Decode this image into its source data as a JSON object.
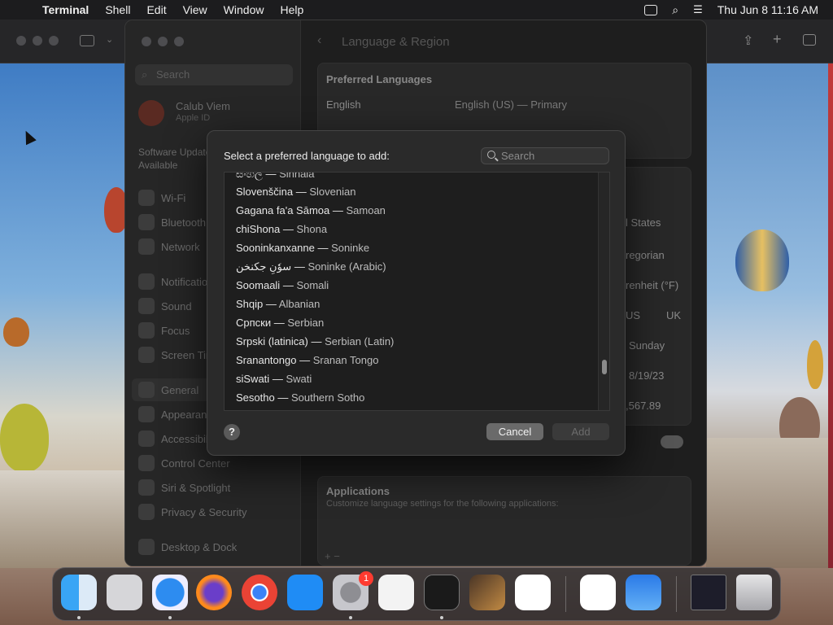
{
  "menubar": {
    "app_name": "Terminal",
    "items": [
      "Shell",
      "Edit",
      "View",
      "Window",
      "Help"
    ],
    "clock": "Thu Jun 8  11:16 AM"
  },
  "settings": {
    "search_placeholder": "Search",
    "user_name": "Calub Viem",
    "user_subtitle": "Apple ID",
    "software_update": "Software Update Available",
    "sidebar_items": [
      "Wi-Fi",
      "Bluetooth",
      "Network",
      "Notifications",
      "Sound",
      "Focus",
      "Screen Time",
      "General",
      "Appearance",
      "Accessibility",
      "Control Center",
      "Siri & Spotlight",
      "Privacy & Security",
      "Desktop & Dock"
    ],
    "title": "Language & Region",
    "preferred_languages_header": "Preferred Languages",
    "language_name": "English",
    "language_detail": "English (US) — Primary",
    "region_value": "l States",
    "calendar_value": "regorian",
    "temperature_value": "renheit (°F)",
    "measurement_us": "US",
    "measurement_uk": "UK",
    "first_day_value": "Sunday",
    "date_format_value": "8/19/23",
    "number_format_value": ",567.89",
    "applications_header": "Applications",
    "applications_subtitle": "Customize language settings for the following applications:",
    "add_remove": "+   −"
  },
  "dialog": {
    "title": "Select a preferred language to add:",
    "search_placeholder": "Search",
    "languages": [
      {
        "native": "සිංහල",
        "english": "Sinhala"
      },
      {
        "native": "Slovenščina",
        "english": "Slovenian"
      },
      {
        "native": "Gagana fa'a Sāmoa",
        "english": "Samoan"
      },
      {
        "native": "chiShona",
        "english": "Shona"
      },
      {
        "native": "Sooninkanxanne",
        "english": "Soninke"
      },
      {
        "native": "سوٗنِ جكنخن",
        "english": "Soninke (Arabic)"
      },
      {
        "native": "Soomaali",
        "english": "Somali"
      },
      {
        "native": "Shqip",
        "english": "Albanian"
      },
      {
        "native": "Српски",
        "english": "Serbian"
      },
      {
        "native": "Srpski (latinica)",
        "english": "Serbian (Latin)"
      },
      {
        "native": "Sranantongo",
        "english": "Sranan Tongo"
      },
      {
        "native": "siSwati",
        "english": "Swati"
      },
      {
        "native": "Sesotho",
        "english": "Southern Sotho"
      }
    ],
    "separator": "—",
    "help_label": "?",
    "cancel_label": "Cancel",
    "add_label": "Add"
  },
  "dock": {
    "apps": [
      "finder-icon",
      "launchpad-icon",
      "safari-icon",
      "firefox-icon",
      "chrome-icon",
      "app-store-icon",
      "system-settings-icon",
      "textedit-icon",
      "terminal-icon",
      "garageband-icon",
      "vscode-icon",
      "visual-studio-icon",
      "weather-icon",
      "terminal-window-icon",
      "trash-icon"
    ],
    "settings_badge": "1"
  }
}
